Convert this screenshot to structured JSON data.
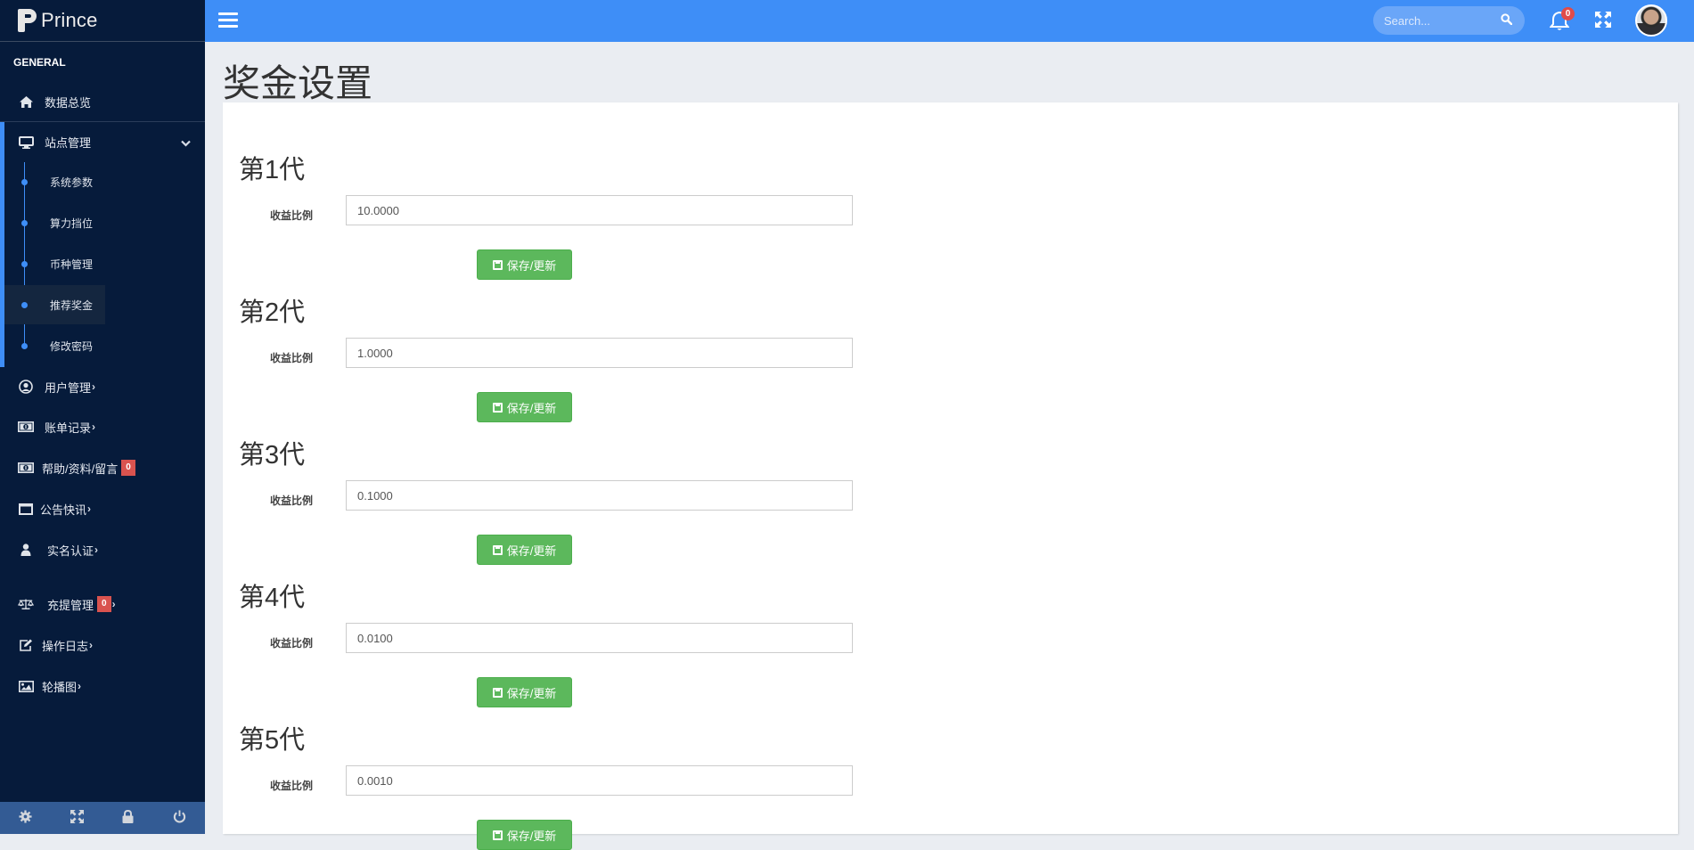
{
  "brand": {
    "name": "Prince"
  },
  "sidebar": {
    "section_title": "GENERAL",
    "items": [
      {
        "label": "数据总览",
        "icon": "home-icon"
      },
      {
        "label": "站点管理",
        "icon": "desktop-icon",
        "expanded": true
      },
      {
        "label": "用户管理",
        "icon": "user-circle-icon"
      },
      {
        "label": "账单记录",
        "icon": "money-icon"
      },
      {
        "label": "帮助/资料/留言",
        "icon": "money-icon",
        "badge": "0"
      },
      {
        "label": "公告快讯",
        "icon": "window-icon"
      },
      {
        "label": "实名认证",
        "icon": "user-icon"
      },
      {
        "label": "充提管理",
        "icon": "balance-scale-icon",
        "badge": "0"
      },
      {
        "label": "操作日志",
        "icon": "edit-icon"
      },
      {
        "label": "轮播图",
        "icon": "image-icon"
      }
    ],
    "sub_items": [
      {
        "label": "系统参数"
      },
      {
        "label": "算力挡位"
      },
      {
        "label": "币种管理"
      },
      {
        "label": "推荐奖金",
        "active": true
      },
      {
        "label": "修改密码"
      }
    ],
    "footer_icons": [
      "gear-icon",
      "expand-icon",
      "lock-icon",
      "power-icon"
    ]
  },
  "topbar": {
    "search_placeholder": "Search...",
    "notification_count": "0"
  },
  "page": {
    "title": "奖金设置",
    "field_label": "收益比例",
    "button_label": "保存/更新",
    "generations": [
      {
        "title": "第1代",
        "value": "10.0000"
      },
      {
        "title": "第2代",
        "value": "1.0000"
      },
      {
        "title": "第3代",
        "value": "0.1000"
      },
      {
        "title": "第4代",
        "value": "0.0100"
      },
      {
        "title": "第5代",
        "value": "0.0010"
      }
    ]
  },
  "colors": {
    "sidebar_bg": "#061b3b",
    "accent": "#3e8ef7",
    "success": "#5cb85c",
    "badge": "#d9534f"
  }
}
